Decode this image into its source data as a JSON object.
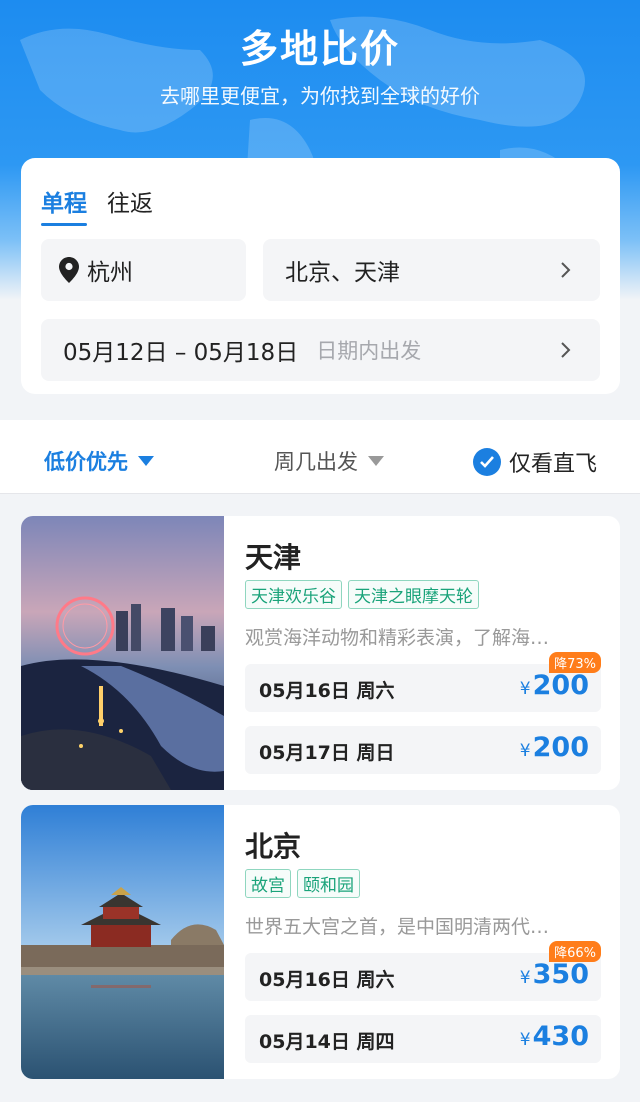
{
  "header": {
    "title": "多地比价",
    "subtitle": "去哪里更便宜，为你找到全球的好价"
  },
  "search": {
    "tabs": [
      {
        "label": "单程",
        "active": true
      },
      {
        "label": "往返",
        "active": false
      }
    ],
    "origin": "杭州",
    "destinations": "北京、天津",
    "date_range": "05月12日 – 05月18日",
    "date_hint": "日期内出发"
  },
  "filters": {
    "sort_label": "低价优先",
    "weekday_label": "周几出发",
    "direct_label": "仅看直飞",
    "direct_checked": true
  },
  "results": [
    {
      "city": "天津",
      "tags": [
        "天津欢乐谷",
        "天津之眼摩天轮"
      ],
      "description": "观赏海洋动物和精彩表演，了解海…",
      "flights": [
        {
          "date": "05月16日 周六",
          "currency": "¥",
          "price": "200",
          "discount": "降73%"
        },
        {
          "date": "05月17日 周日",
          "currency": "¥",
          "price": "200",
          "discount": ""
        }
      ]
    },
    {
      "city": "北京",
      "tags": [
        "故宫",
        "颐和园"
      ],
      "description": "世界五大宫之首，是中国明清两代…",
      "flights": [
        {
          "date": "05月16日 周六",
          "currency": "¥",
          "price": "350",
          "discount": "降66%"
        },
        {
          "date": "05月14日 周四",
          "currency": "¥",
          "price": "430",
          "discount": ""
        }
      ]
    }
  ],
  "colors": {
    "accent": "#1b7fe0",
    "tag_green": "#1aa37a",
    "discount_orange": "#ff7d1a"
  }
}
